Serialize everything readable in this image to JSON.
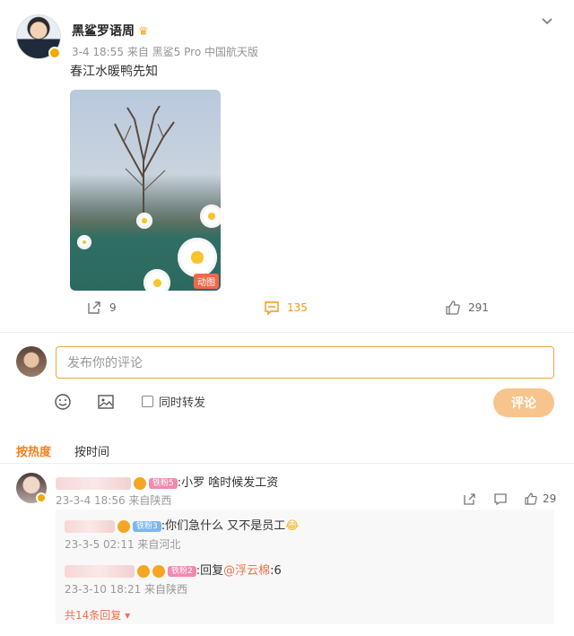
{
  "post": {
    "author": "黑鲨罗语周",
    "time": "3-4 18:55",
    "source_prefix": "来自",
    "source": "黑鲨5 Pro 中国航天版",
    "text": "春江水暖鸭先知",
    "media_badge": "动图"
  },
  "actions": {
    "repost_count": "9",
    "comment_count": "135",
    "like_count": "291"
  },
  "composer": {
    "placeholder": "发布你的评论",
    "repost_label": "同时转发",
    "submit_label": "评论"
  },
  "sort": {
    "hot_label": "按热度",
    "time_label": "按时间"
  },
  "comments": [
    {
      "fan_badge": "铁粉5",
      "text": ":小罗 啥时候发工资",
      "meta": "23-3-4 18:56 来自陕西",
      "like_count": "29",
      "replies": [
        {
          "fan_badge": "铁粉3",
          "text": ":你们急什么 又不是员工",
          "meta": "23-3-5 02:11 来自河北"
        },
        {
          "fan_badge": "铁粉2",
          "reply_prefix": ":回复",
          "mention": "@浮云棉",
          "reply_suffix": ":6",
          "meta": "23-3-10 18:21 来自陕西"
        }
      ],
      "more_replies": "共14条回复"
    }
  ],
  "colors": {
    "accent_orange": "#f2801e",
    "link_orange": "#eb7350",
    "submit_disabled": "#f7c48e",
    "input_border": "#f0a43a"
  }
}
